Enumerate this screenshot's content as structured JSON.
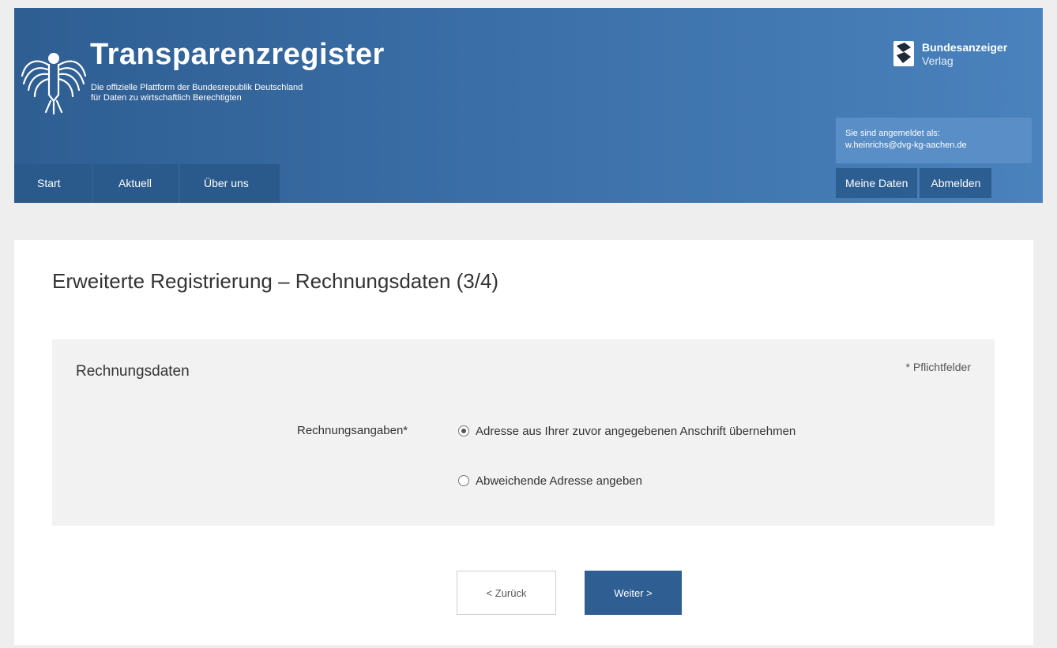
{
  "header": {
    "brand_title": "Transparenzregister",
    "brand_subtitle_line1": "Die offizielle Plattform der Bundesrepublik Deutschland",
    "brand_subtitle_line2": "für Daten zu wirtschaftlich Berechtigten",
    "publisher_name": "Bundesanzeiger",
    "publisher_sub": "Verlag",
    "login_label": "Sie sind angemeldet als:",
    "login_user": "w.heinrichs@dvg-kg-aachen.de",
    "nav": [
      {
        "label": "Start"
      },
      {
        "label": "Aktuell"
      },
      {
        "label": "Über uns"
      }
    ],
    "nav_right": [
      {
        "label": "Meine Daten"
      },
      {
        "label": "Abmelden"
      }
    ]
  },
  "main": {
    "page_title": "Erweiterte Registrierung – Rechnungsdaten (3/4)",
    "panel": {
      "title": "Rechnungsdaten",
      "required_note": "* Pflichtfelder",
      "field_label": "Rechnungsangaben*",
      "options": [
        {
          "label": "Adresse aus Ihrer zuvor angegebenen Anschrift übernehmen",
          "selected": true
        },
        {
          "label": "Abweichende Adresse angeben",
          "selected": false
        }
      ]
    },
    "buttons": {
      "back_label": "< Zurück",
      "next_label": "Weiter >"
    }
  },
  "colors": {
    "header_dark": "#2e5e92",
    "header_light": "#4a82bd",
    "primary_button": "#2e5e92",
    "panel_bg": "#f2f2f2"
  }
}
